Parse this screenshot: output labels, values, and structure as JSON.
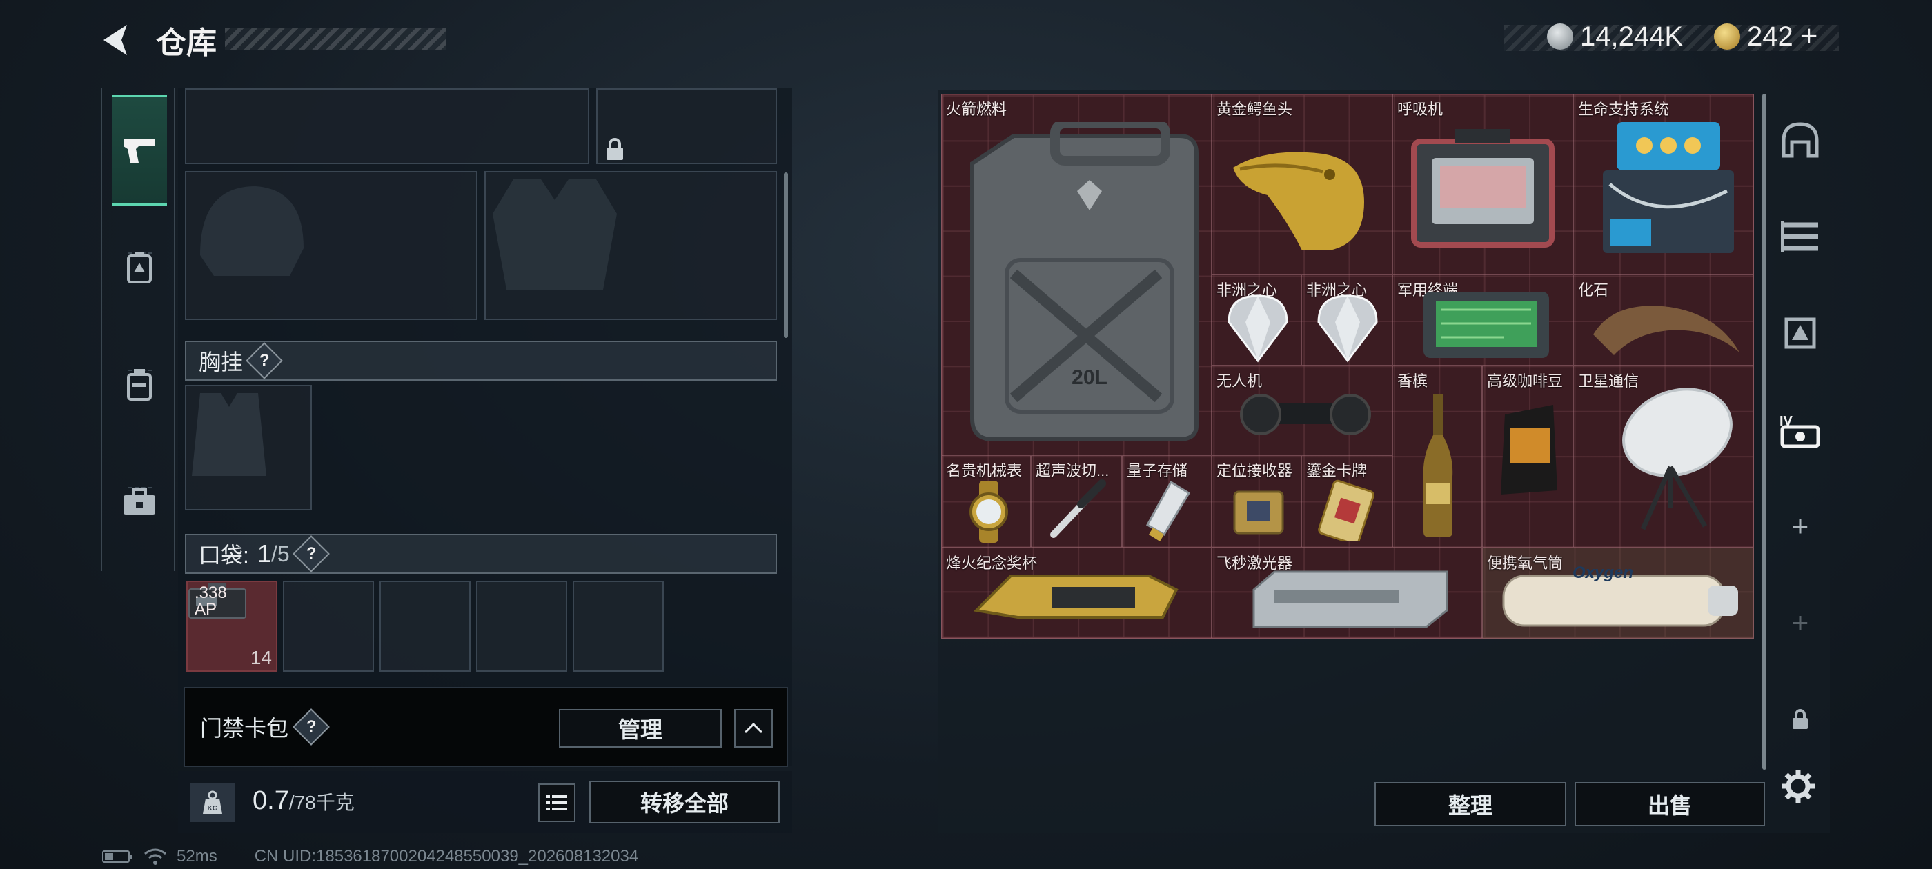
{
  "header": {
    "title": "仓库",
    "back_icon": "back-arrow-icon",
    "currencies": [
      {
        "icon": "silver-coin-icon",
        "value": "14,244K"
      },
      {
        "icon": "gold-coin-icon",
        "value": "242",
        "plus": "+"
      }
    ]
  },
  "left_tabs": [
    {
      "icon": "pistol-icon",
      "active": true
    },
    {
      "icon": "armor-pouch-icon",
      "active": false
    },
    {
      "icon": "backpack-icon",
      "active": false
    },
    {
      "icon": "toolbox-icon",
      "active": false
    }
  ],
  "loadout": {
    "chest_rig": {
      "label": "胸挂",
      "help": "?"
    },
    "pockets": {
      "label": "口袋:",
      "used": "1",
      "total": "/5",
      "help": "?"
    },
    "pocket_item": {
      "name": ".338\nAP",
      "count": "14"
    },
    "keycard": {
      "label": "门禁卡包",
      "help": "?",
      "manage": "管理"
    },
    "weight": {
      "current": "0.7",
      "capacity": "/78千克",
      "transfer_all": "转移全部"
    }
  },
  "status": {
    "ping": "52ms",
    "uid": "CN UID:1853618700204248550039_202608132034"
  },
  "stash": {
    "items": [
      {
        "name": "火箭燃料",
        "icon": "jerrycan-icon"
      },
      {
        "name": "黄金鳄鱼头",
        "icon": "gold-croc-head-icon"
      },
      {
        "name": "呼吸机",
        "icon": "respirator-icon"
      },
      {
        "name": "生命支持系统",
        "icon": "life-support-icon"
      },
      {
        "name": "非洲之心",
        "icon": "diamond-icon"
      },
      {
        "name": "非洲之心",
        "icon": "diamond-icon"
      },
      {
        "name": "军用终端",
        "icon": "terminal-icon"
      },
      {
        "name": "化石",
        "icon": "fossil-claw-icon"
      },
      {
        "name": "无人机",
        "icon": "drone-icon"
      },
      {
        "name": "香槟",
        "icon": "champagne-icon"
      },
      {
        "name": "高级咖啡豆",
        "icon": "coffee-bag-icon"
      },
      {
        "name": "卫星通信",
        "icon": "satellite-dish-icon"
      },
      {
        "name": "名贵机械表",
        "icon": "watch-icon"
      },
      {
        "name": "超声波切...",
        "icon": "ultrasonic-cutter-icon"
      },
      {
        "name": "量子存储",
        "icon": "usb-drive-icon"
      },
      {
        "name": "定位接收器",
        "icon": "gps-receiver-icon"
      },
      {
        "name": "鎏金卡牌",
        "icon": "gold-card-icon"
      },
      {
        "name": "烽火纪念奖杯",
        "icon": "trophy-icon"
      },
      {
        "name": "飞秒激光器",
        "icon": "laser-device-icon"
      },
      {
        "name": "便携氧气筒",
        "icon": "oxygen-tank-icon",
        "print": "Oxygen"
      }
    ]
  },
  "right_tabs": [
    "helmet-icon",
    "rifle-rack-icon",
    "armor-rack-icon",
    "level-iv-icon",
    "add-icon",
    "add-icon",
    "lock-icon"
  ],
  "actions": {
    "sort": "整理",
    "sell": "出售"
  },
  "colors": {
    "accent": "#5dd6b0",
    "stash_bg": "#3b1c22",
    "panel": "#101820"
  }
}
